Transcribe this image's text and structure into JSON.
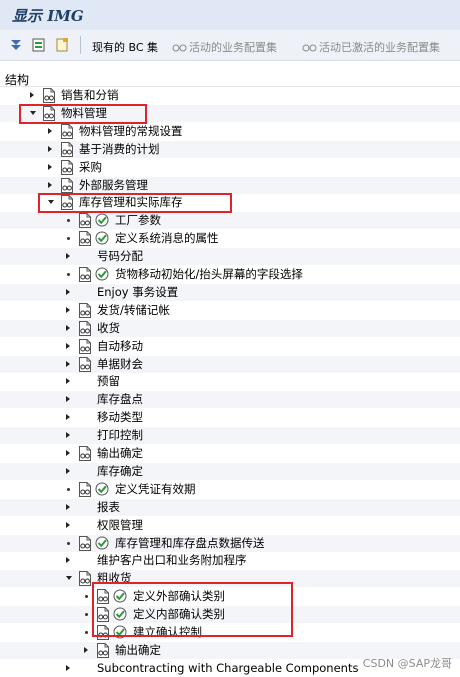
{
  "window": {
    "title": "显示 IMG"
  },
  "toolbar": {
    "bc_sets": "现有的 BC 集",
    "active_config": "活动的业务配置集",
    "activated_active_config": "活动已激活的业务配置集"
  },
  "structure_label": "结构",
  "tree": [
    {
      "label": "销售和分销",
      "level": 0,
      "toggle": "collapsed",
      "exec": false
    },
    {
      "label": "物料管理",
      "level": 0,
      "toggle": "expanded",
      "exec": false
    },
    {
      "label": "物料管理的常规设置",
      "level": 1,
      "toggle": "collapsed",
      "exec": false
    },
    {
      "label": "基于消费的计划",
      "level": 1,
      "toggle": "collapsed",
      "exec": false
    },
    {
      "label": "采购",
      "level": 1,
      "toggle": "collapsed",
      "exec": false
    },
    {
      "label": "外部服务管理",
      "level": 1,
      "toggle": "collapsed",
      "exec": false
    },
    {
      "label": "库存管理和实际库存",
      "level": 1,
      "toggle": "expanded",
      "exec": false
    },
    {
      "label": "工厂参数",
      "level": 2,
      "toggle": "none",
      "exec": true
    },
    {
      "label": "定义系统消息的属性",
      "level": 2,
      "toggle": "none",
      "exec": true
    },
    {
      "label": "号码分配",
      "level": 2,
      "toggle": "collapsed",
      "exec": false,
      "noicon": true
    },
    {
      "label": "货物移动初始化/抬头屏幕的字段选择",
      "level": 2,
      "toggle": "none",
      "exec": true
    },
    {
      "label": "Enjoy 事务设置",
      "level": 2,
      "toggle": "collapsed",
      "exec": false,
      "noicon": true
    },
    {
      "label": "发货/转储记帐",
      "level": 2,
      "toggle": "collapsed",
      "exec": false
    },
    {
      "label": "收货",
      "level": 2,
      "toggle": "collapsed",
      "exec": false
    },
    {
      "label": "自动移动",
      "level": 2,
      "toggle": "collapsed",
      "exec": false
    },
    {
      "label": "单据财会",
      "level": 2,
      "toggle": "collapsed",
      "exec": false
    },
    {
      "label": "预留",
      "level": 2,
      "toggle": "collapsed",
      "exec": false,
      "noicon": true
    },
    {
      "label": "库存盘点",
      "level": 2,
      "toggle": "collapsed",
      "exec": false,
      "noicon": true
    },
    {
      "label": "移动类型",
      "level": 2,
      "toggle": "collapsed",
      "exec": false,
      "noicon": true
    },
    {
      "label": "打印控制",
      "level": 2,
      "toggle": "collapsed",
      "exec": false,
      "noicon": true
    },
    {
      "label": "输出确定",
      "level": 2,
      "toggle": "collapsed",
      "exec": false
    },
    {
      "label": "库存确定",
      "level": 2,
      "toggle": "collapsed",
      "exec": false,
      "noicon": true
    },
    {
      "label": "定义凭证有效期",
      "level": 2,
      "toggle": "none",
      "exec": true
    },
    {
      "label": "报表",
      "level": 2,
      "toggle": "collapsed",
      "exec": false,
      "noicon": true
    },
    {
      "label": "权限管理",
      "level": 2,
      "toggle": "collapsed",
      "exec": false,
      "noicon": true
    },
    {
      "label": "库存管理和库存盘点数据传送",
      "level": 2,
      "toggle": "none",
      "exec": true
    },
    {
      "label": "维护客户出口和业务附加程序",
      "level": 2,
      "toggle": "collapsed",
      "exec": false,
      "noicon": true
    },
    {
      "label": "粗收货",
      "level": 2,
      "toggle": "expanded",
      "exec": false
    },
    {
      "label": "定义外部确认类别",
      "level": 3,
      "toggle": "none",
      "exec": true
    },
    {
      "label": "定义内部确认类别",
      "level": 3,
      "toggle": "none",
      "exec": true
    },
    {
      "label": "建立确认控制",
      "level": 3,
      "toggle": "none",
      "exec": true
    },
    {
      "label": "输出确定",
      "level": 3,
      "toggle": "collapsed",
      "exec": false
    },
    {
      "label": "Subcontracting with Chargeable Components",
      "level": 2,
      "toggle": "collapsed",
      "exec": false,
      "noicon": true
    }
  ],
  "watermark": "CSDN @SAP龙哥",
  "colors": {
    "highlight": "#e0232b",
    "title": "#1f3f66",
    "exec_icon": "#2e9a3c"
  }
}
